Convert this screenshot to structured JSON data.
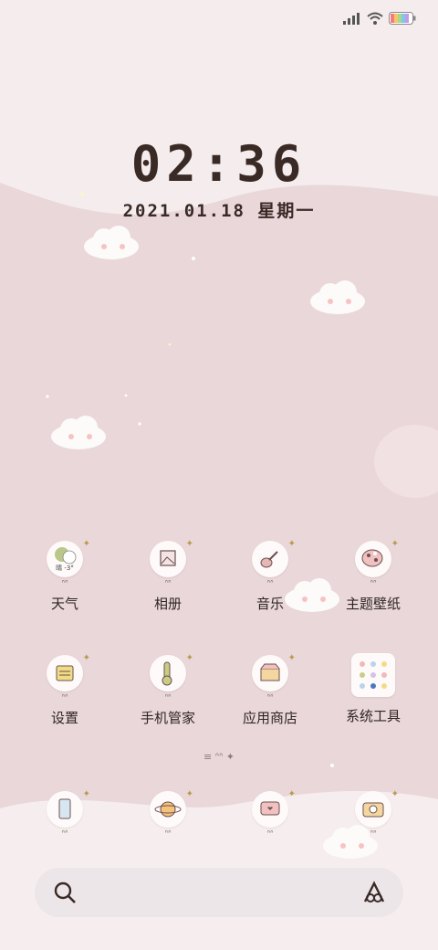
{
  "status_bar": {
    "signal_icon": "signal-bars-icon",
    "wifi_icon": "wifi-icon",
    "battery_icon": "battery-icon"
  },
  "clock": {
    "time": "02:36",
    "date": "2021.01.18 星期一"
  },
  "apps": [
    {
      "label": "天气",
      "icon": "weather-icon",
      "badge": "晴 -3°"
    },
    {
      "label": "相册",
      "icon": "gallery-icon"
    },
    {
      "label": "音乐",
      "icon": "music-icon"
    },
    {
      "label": "主题壁纸",
      "icon": "palette-icon"
    },
    {
      "label": "设置",
      "icon": "settings-icon"
    },
    {
      "label": "手机管家",
      "icon": "thermometer-icon"
    },
    {
      "label": "应用商店",
      "icon": "store-icon"
    },
    {
      "label": "系统工具",
      "icon": "folder-grid-icon"
    }
  ],
  "dock": [
    {
      "icon": "phone-icon"
    },
    {
      "icon": "browser-planet-icon"
    },
    {
      "icon": "messages-icon"
    },
    {
      "icon": "camera-icon"
    }
  ],
  "search_bar": {
    "search_icon": "search-icon",
    "assistant_icon": "assistant-icon"
  },
  "colors": {
    "background": "#e9d7da",
    "top_band": "#f5eded",
    "text_dark": "#2f2524",
    "search_bar": "#ece6e8"
  }
}
